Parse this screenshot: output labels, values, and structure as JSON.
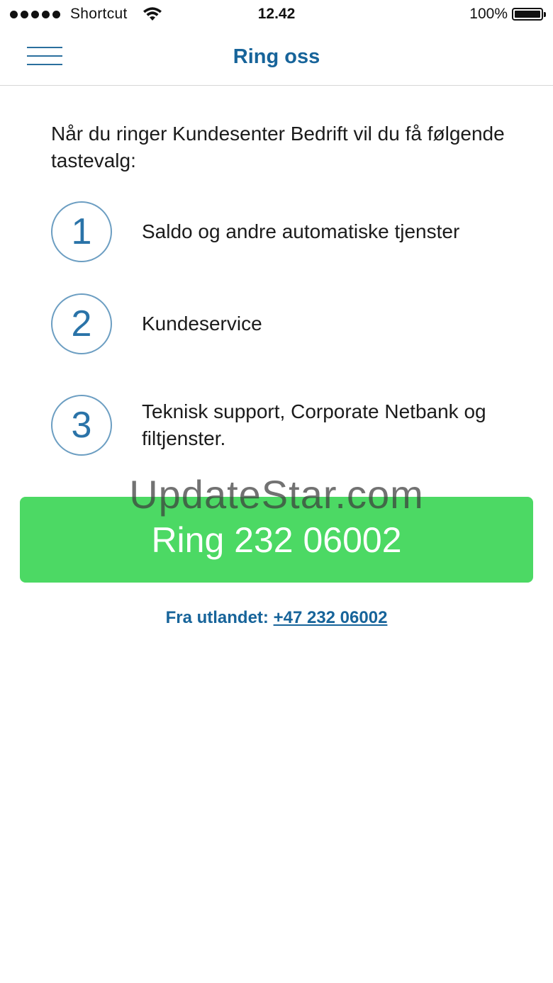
{
  "status_bar": {
    "carrier": "Shortcut",
    "time": "12.42",
    "battery_percent": "100%",
    "signal_strength": 5,
    "battery_level": 1.0
  },
  "nav": {
    "title": "Ring oss",
    "menu_icon": "hamburger-menu-icon"
  },
  "intro_text": "Når du ringer Kundesenter Bedrift vil du få følgende tastevalg:",
  "options": [
    {
      "number": "1",
      "label": "Saldo og andre automatiske tjenster"
    },
    {
      "number": "2",
      "label": "Kundeservice"
    },
    {
      "number": "3",
      "label": "Teknisk support, Corporate Netbank og filtjenster."
    }
  ],
  "watermark": "UpdateStar.com",
  "call_button": {
    "label": "Ring 232 06002"
  },
  "abroad": {
    "prefix": "Fra utlandet: ",
    "number": "+47 232 06002"
  },
  "colors": {
    "accent_blue": "#17649a",
    "call_green": "#4cd964",
    "circle_border": "#6c9ec2"
  }
}
